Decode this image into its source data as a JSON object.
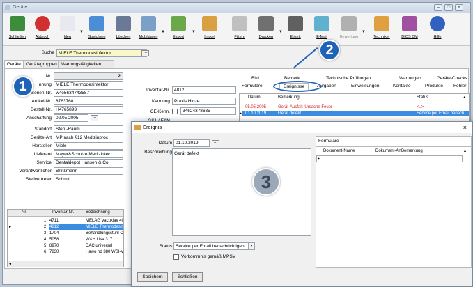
{
  "window": {
    "title": "Geräte"
  },
  "toolbar": [
    {
      "label": "Schließen",
      "color": "#3c8c3c"
    },
    {
      "label": "Abbruch",
      "color": "#d03030"
    },
    {
      "label": "Neu",
      "color": "#e8e8f0"
    },
    {
      "label": "Speichern",
      "color": "#4a8ed8"
    },
    {
      "label": "Löschen",
      "color": "#6a7a96"
    },
    {
      "label": "Mobildaten",
      "color": "#7aa0c8"
    },
    {
      "label": "Export",
      "color": "#6aa84a"
    },
    {
      "label": "Import",
      "color": "#d8a040"
    },
    {
      "label": "Filtern",
      "color": "#c0c0c0"
    },
    {
      "label": "Drucken",
      "color": "#707070"
    },
    {
      "label": "Etikett",
      "color": "#606060"
    },
    {
      "label": "E-Mail",
      "color": "#60b0d0"
    },
    {
      "label": "Bewertung",
      "color": "#b0b0b0"
    },
    {
      "label": "Techniker",
      "color": "#e0a040"
    },
    {
      "label": "DIOS DM",
      "color": "#a050a0"
    },
    {
      "label": "Hilfe",
      "color": "#3060c0"
    }
  ],
  "search": {
    "label": "Suche",
    "value": "MIELE Thermodesinfektor"
  },
  "tabs": {
    "t1": "Geräte",
    "t2": "Gerätegruppen",
    "t3": "Wartungstätigkeiten"
  },
  "form": {
    "nr_label": "Nr.",
    "nr_value": "2",
    "bez_label": "nnung",
    "bez_value": "MIELE Thermodesinfektor",
    "serien_label": "Serien-Nr.",
    "serien_value": "w4e5634743587",
    "artikel_label": "Artikel-Nr.",
    "artikel_value": "8763768",
    "bestell_label": "Bestell-Nr.",
    "bestell_value": "H4765893",
    "anschaffung_label": "Anschaffung",
    "anschaffung_value": "02.05.2005",
    "standort_label": "Standort",
    "standort_value": "Steri.-Raum",
    "geraeteart_label": "Geräte-Art",
    "geraeteart_value": "MP nach §12 Medizinproc",
    "hersteller_label": "Hersteller",
    "hersteller_value": "Miele",
    "lieferant_label": "Lieferant",
    "lieferant_value": "Mayer&Schulze Medizintec",
    "service_label": "Service",
    "service_value": "Dentaldepot Hansen & Co.",
    "verantw_label": "Verantwortlicher",
    "verantw_value": "Brinkmann",
    "stellv_label": "Stellvertreter",
    "stellv_value": "Schmitt",
    "inventar_label": "Inventar-Nr.",
    "inventar_value": "4812",
    "kennung_label": "Kennung",
    "kennung_value": "Praxis Hinze",
    "ce_label": "CE-Kenn.",
    "ce_value": "34624378635",
    "gs1_label": "GS1 / EAN"
  },
  "device_list": {
    "headers": [
      "Nr.",
      "Inventar-Nr.",
      "Bezeichnung"
    ],
    "rows": [
      [
        "1",
        "4711",
        "MELAG Vacuklav 40"
      ],
      [
        "2",
        "4812",
        "MIELE Thermodesinf"
      ],
      [
        "3",
        "1704",
        "Behandlungsstuhl C5"
      ],
      [
        "4",
        "5058",
        "W&H Lisa 317"
      ],
      [
        "5",
        "8970",
        "DAC universal"
      ],
      [
        "6",
        "7830",
        "Hawo hd 380 WSI-V"
      ]
    ]
  },
  "right_tabs_row1": [
    "Bild",
    "Bemerk",
    "Technische Prüfungen",
    "Wartungen",
    "Geräte-Checks"
  ],
  "right_tabs_row2": [
    "Formulare",
    "Ereignisse",
    "Aufgaben",
    "Einweisungen",
    "Kontakte",
    "Produkte",
    "Fehler"
  ],
  "events": {
    "headers": [
      "Datum",
      "Bemerkung",
      "Status"
    ],
    "rows": [
      {
        "datum": "05.05.2005",
        "bemerkung": "Gerät-Ausfall: Ursache Feuer",
        "status": "<..>"
      },
      {
        "datum": "01.10.2019",
        "bemerkung": "Gerät defekt",
        "status": "Service per Email benach"
      }
    ]
  },
  "dialog": {
    "title": "Ereignis",
    "datum_label": "Datum",
    "datum_value": "01.10.2019",
    "beschreibung_label": "Beschreibung",
    "beschreibung_value": "Gerät defekt",
    "status_label": "Status",
    "status_value": "Service per Email benachrichtigen",
    "vorkommnis_label": "Vorkommnis gemäß MPSV",
    "save_label": "Speichern",
    "close_label": "Schließen",
    "formulare_tab": "Formulare",
    "doc_headers": [
      "Dokument-Name",
      "Dokument-Art",
      "Bemerkung"
    ]
  },
  "badges": {
    "b1": "1",
    "b2": "2",
    "b3": "3"
  }
}
